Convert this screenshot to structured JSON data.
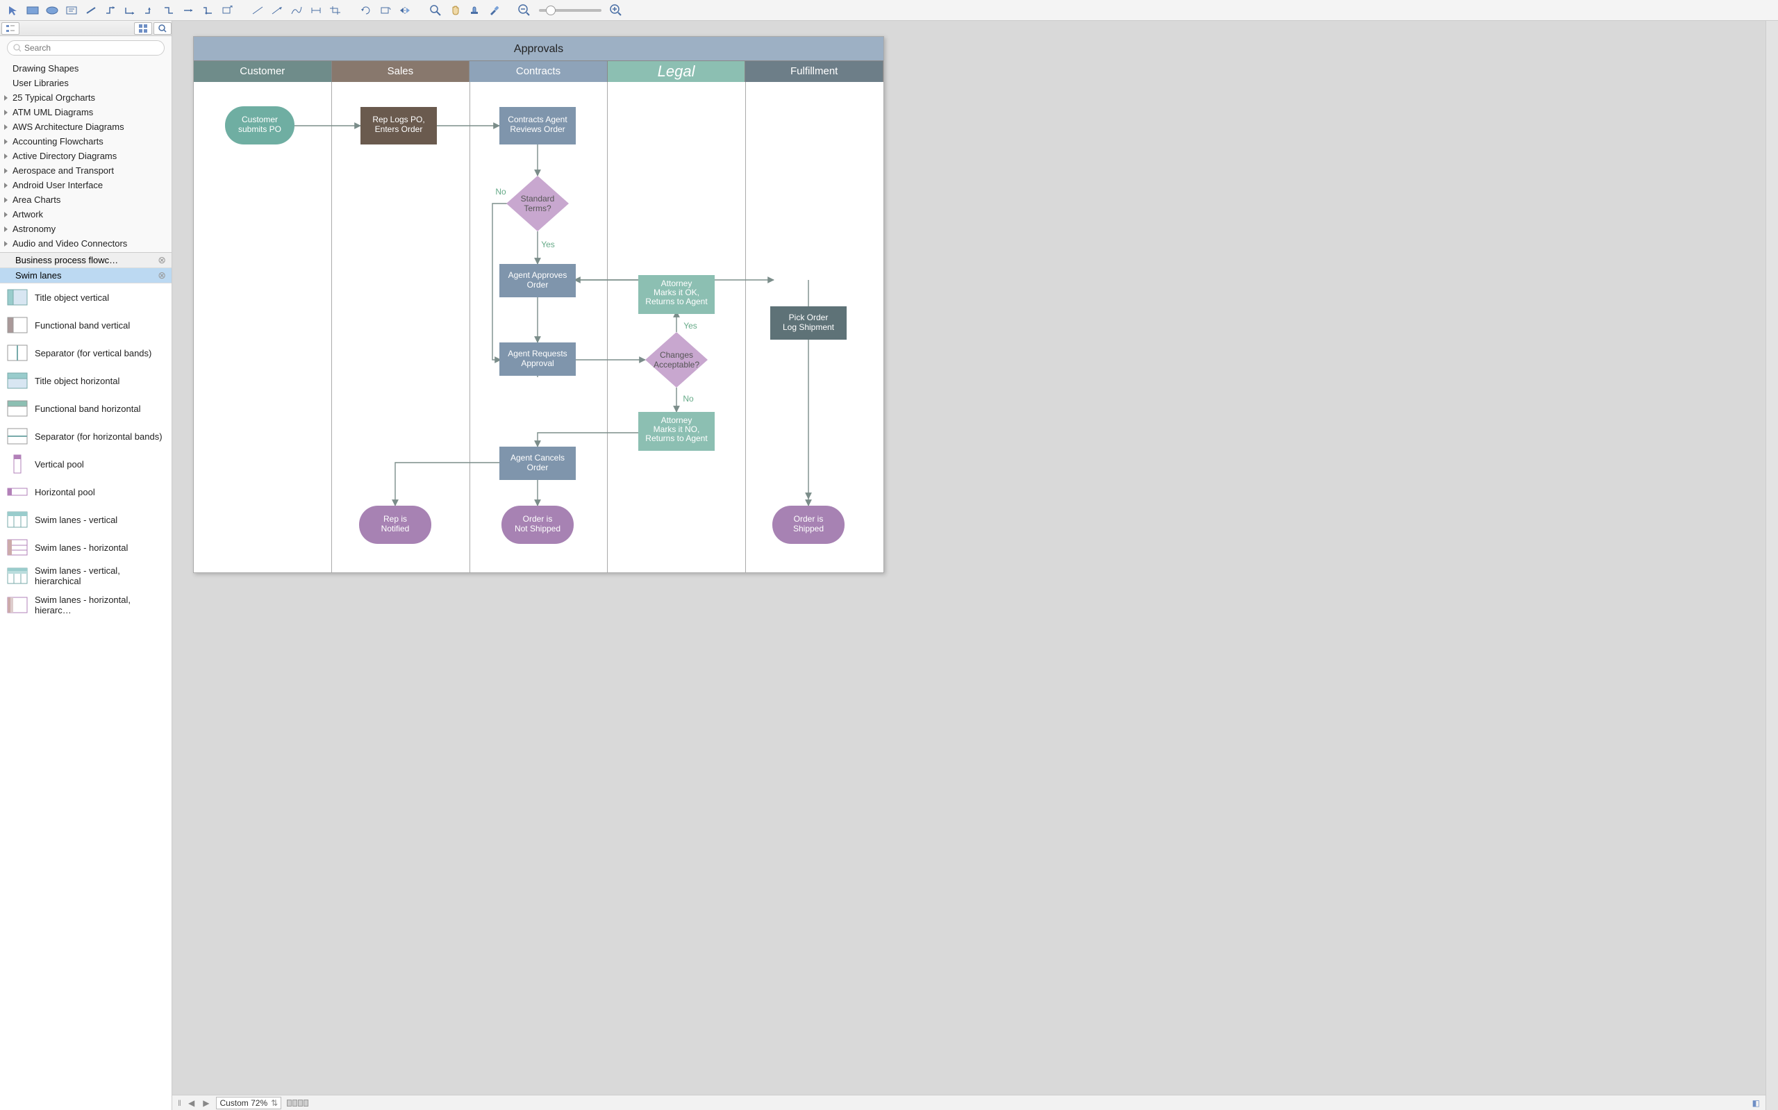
{
  "search": {
    "placeholder": "Search"
  },
  "library_categories_top": [
    {
      "label": "Drawing Shapes",
      "group": false
    },
    {
      "label": "User Libraries",
      "group": false
    }
  ],
  "library_categories": [
    "25 Typical Orgcharts",
    "ATM UML Diagrams",
    "AWS Architecture Diagrams",
    "Accounting Flowcharts",
    "Active Directory Diagrams",
    "Aerospace and Transport",
    "Android User Interface",
    "Area Charts",
    "Artwork",
    "Astronomy",
    "Audio and Video Connectors"
  ],
  "open_tabs": [
    {
      "label": "Business process flowc…",
      "active": false
    },
    {
      "label": "Swim lanes",
      "active": true
    }
  ],
  "shape_items": [
    "Title object vertical",
    "Functional band vertical",
    "Separator (for vertical bands)",
    "Title object horizontal",
    "Functional band horizontal",
    "Separator (for horizontal bands)",
    "Vertical pool",
    "Horizontal pool",
    "Swim lanes - vertical",
    "Swim lanes - horizontal",
    "Swim lanes - vertical, hierarchical"
  ],
  "shape_items_cut": "Swim lanes - horizontal, hierarc…",
  "zoom_label": "Custom 72%",
  "chart_data": {
    "type": "swimlane-flowchart",
    "title": "Approvals",
    "lanes": [
      {
        "id": "customer",
        "label": "Customer",
        "header_color": "#6f8c8a"
      },
      {
        "id": "sales",
        "label": "Sales",
        "header_color": "#88786d"
      },
      {
        "id": "contracts",
        "label": "Contracts",
        "header_color": "#8ea3b9"
      },
      {
        "id": "legal",
        "label": "Legal",
        "header_color": "#8cbfb2",
        "emphasis": true
      },
      {
        "id": "fulfillment",
        "label": "Fulfillment",
        "header_color": "#6d7e88"
      }
    ],
    "nodes": [
      {
        "id": "n_submit",
        "lane": "customer",
        "type": "start-end",
        "label": "Customer\nsubmits PO",
        "fill": "#6faea2",
        "text": "#fff"
      },
      {
        "id": "n_rep",
        "lane": "sales",
        "type": "process",
        "label": "Rep Logs PO,\nEnters Order",
        "fill": "#6a5a4e",
        "text": "#fff"
      },
      {
        "id": "n_review",
        "lane": "contracts",
        "type": "process",
        "label": "Contracts Agent\nReviews Order",
        "fill": "#7f95ac",
        "text": "#fff"
      },
      {
        "id": "n_terms",
        "lane": "contracts",
        "type": "decision",
        "label": "Standard\nTerms?",
        "fill": "#c8a7cf",
        "text": "#555"
      },
      {
        "id": "n_approve",
        "lane": "contracts",
        "type": "process",
        "label": "Agent Approves\nOrder",
        "fill": "#7f95ac",
        "text": "#fff"
      },
      {
        "id": "n_req",
        "lane": "contracts",
        "type": "process",
        "label": "Agent Requests\nApproval",
        "fill": "#7f95ac",
        "text": "#fff"
      },
      {
        "id": "n_ok",
        "lane": "legal",
        "type": "process",
        "label": "Attorney\nMarks it OK,\nReturns to Agent",
        "fill": "#8cbfb2",
        "text": "#fff"
      },
      {
        "id": "n_chg",
        "lane": "legal",
        "type": "decision",
        "label": "Changes\nAcceptable?",
        "fill": "#c8a7cf",
        "text": "#555"
      },
      {
        "id": "n_no",
        "lane": "legal",
        "type": "process",
        "label": "Attorney\nMarks it NO,\nReturns to Agent",
        "fill": "#8cbfb2",
        "text": "#fff"
      },
      {
        "id": "n_cancel",
        "lane": "contracts",
        "type": "process",
        "label": "Agent Cancels\nOrder",
        "fill": "#7f95ac",
        "text": "#fff"
      },
      {
        "id": "n_pick",
        "lane": "fulfillment",
        "type": "process",
        "label": "Pick Order\nLog Shipment",
        "fill": "#5e7277",
        "text": "#fff"
      },
      {
        "id": "n_notif",
        "lane": "sales",
        "type": "terminator",
        "label": "Rep is\nNotified",
        "fill": "#a782b3",
        "text": "#fff"
      },
      {
        "id": "n_notship",
        "lane": "contracts",
        "type": "terminator",
        "label": "Order is\nNot Shipped",
        "fill": "#a782b3",
        "text": "#fff"
      },
      {
        "id": "n_ship",
        "lane": "fulfillment",
        "type": "terminator",
        "label": "Order is\nShipped",
        "fill": "#a782b3",
        "text": "#fff"
      }
    ],
    "edges": [
      {
        "from": "n_submit",
        "to": "n_rep"
      },
      {
        "from": "n_rep",
        "to": "n_review"
      },
      {
        "from": "n_review",
        "to": "n_terms"
      },
      {
        "from": "n_terms",
        "to": "n_approve",
        "label": "Yes"
      },
      {
        "from": "n_terms",
        "to": "n_req",
        "label": "No"
      },
      {
        "from": "n_approve",
        "to": "n_pick"
      },
      {
        "from": "n_req",
        "to": "n_chg"
      },
      {
        "from": "n_chg",
        "to": "n_ok",
        "label": "Yes"
      },
      {
        "from": "n_chg",
        "to": "n_no",
        "label": "No"
      },
      {
        "from": "n_ok",
        "to": "n_approve"
      },
      {
        "from": "n_no",
        "to": "n_cancel"
      },
      {
        "from": "n_cancel",
        "to": "n_notif"
      },
      {
        "from": "n_cancel",
        "to": "n_notship"
      },
      {
        "from": "n_pick",
        "to": "n_ship"
      }
    ],
    "edge_labels": {
      "yes": "Yes",
      "no": "No"
    }
  }
}
